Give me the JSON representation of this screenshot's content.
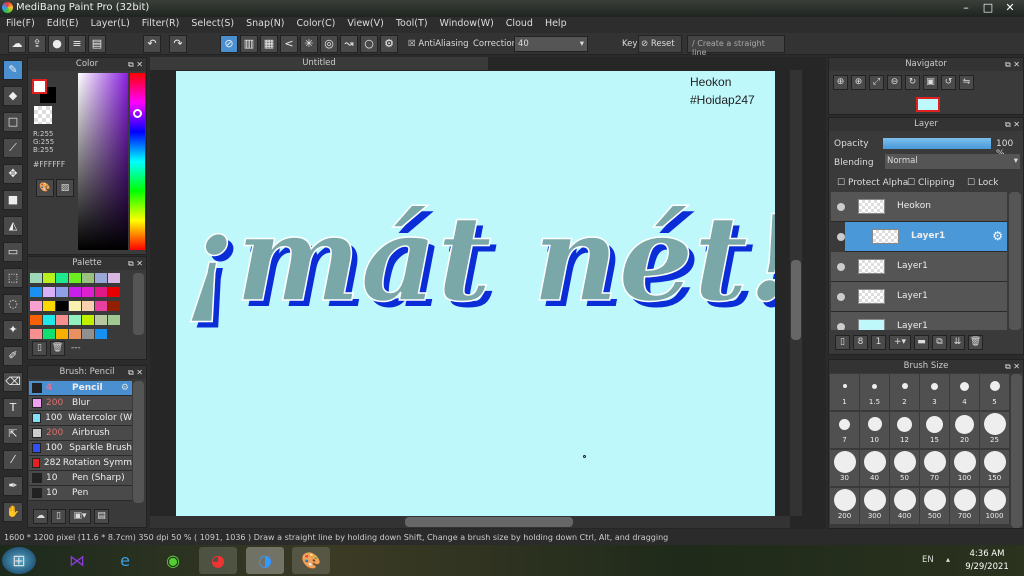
{
  "app": {
    "title": "MediBang Paint Pro (32bit)"
  },
  "menu": [
    "File(F)",
    "Edit(E)",
    "Layer(L)",
    "Filter(R)",
    "Select(S)",
    "Snap(N)",
    "Color(C)",
    "View(V)",
    "Tool(T)",
    "Window(W)",
    "Cloud",
    "Help"
  ],
  "toolbar": {
    "antialiasing": "AntiAliasing",
    "correction_label": "Correction",
    "correction_value": "40",
    "key": "Key",
    "reset": "Reset",
    "straight_line": "Create a straight line"
  },
  "color_panel": {
    "title": "Color",
    "r": "R:255",
    "g": "G:255",
    "b": "B:255",
    "hex": "#FFFFFF",
    "accent": "#4a90d0"
  },
  "palette": {
    "title": "Palette",
    "colors": [
      "#9ed9b8",
      "#b8f21a",
      "#20e88c",
      "#6cee20",
      "#9cc080",
      "#9aa8d8",
      "#d8b8e0",
      "#1a90f0",
      "#d8b0f8",
      "#90a0e8",
      "#c820e8",
      "#e020d0",
      "#e01888",
      "#e80000",
      "#f8a0d0",
      "#f8d800",
      "#000000",
      "#f8f0b0",
      "#f8d0b0",
      "#e840a0",
      "#902000",
      "#f86000",
      "#20e8e8",
      "#f89090",
      "#90f0c0",
      "#c0f000",
      "#b8c8a0",
      "#a0c890",
      "#f89090",
      "#10e070",
      "#f8b000",
      "#e89060",
      "#909090",
      "#1890f0"
    ],
    "label": "---"
  },
  "brush_panel": {
    "title": "Brush: Pencil",
    "items": [
      {
        "size": "4",
        "name": "Pencil",
        "color": "#222222",
        "size_color": "#e07090",
        "selected": true
      },
      {
        "size": "200",
        "name": "Blur",
        "color": "#f0a0f0",
        "size_color": "#e07070"
      },
      {
        "size": "100",
        "name": "Watercolor (W",
        "color": "#80e0f8",
        "size_color": "#eeeeee"
      },
      {
        "size": "200",
        "name": "Airbrush",
        "color": "#cccccc",
        "size_color": "#e07070"
      },
      {
        "size": "100",
        "name": "Sparkle Brush",
        "color": "#3050f0",
        "size_color": "#eeeeee"
      },
      {
        "size": "282",
        "name": "Rotation Symm",
        "color": "#e82020",
        "size_color": "#eeeeee"
      },
      {
        "size": "10",
        "name": "Pen (Sharp)",
        "color": "#222222",
        "size_color": "#eeeeee"
      },
      {
        "size": "10",
        "name": "Pen",
        "color": "#222222",
        "size_color": "#eeeeee"
      }
    ]
  },
  "document": {
    "tab": "Untitled",
    "signature_line1": "Heokon",
    "signature_line2": "#Hoidap247",
    "artwork_text": "¡mát nét!",
    "canvas_color": "#bff8fb"
  },
  "navigator": {
    "title": "Navigator"
  },
  "layer_panel": {
    "title": "Layer",
    "opacity_label": "Opacity",
    "opacity_value": "100 %",
    "opacity": 1.0,
    "blending_label": "Blending",
    "blending_value": "Normal",
    "protect_alpha": "Protect Alpha",
    "clipping": "Clipping",
    "lock": "Lock",
    "layers": [
      {
        "name": "Heokon",
        "selected": false
      },
      {
        "name": "Layer1",
        "selected": true
      },
      {
        "name": "Layer1",
        "selected": false
      },
      {
        "name": "Layer1",
        "selected": false
      },
      {
        "name": "Layer1",
        "selected": false
      }
    ]
  },
  "brush_size": {
    "title": "Brush Size",
    "sizes": [
      "1",
      "1.5",
      "2",
      "3",
      "4",
      "5",
      "7",
      "10",
      "12",
      "15",
      "20",
      "25",
      "30",
      "40",
      "50",
      "70",
      "100",
      "150",
      "200",
      "300",
      "400",
      "500",
      "700",
      "1000"
    ]
  },
  "status": {
    "text": "1600 * 1200 pixel  (11.6 * 8.7cm)  350 dpi  50 %  ( 1091, 1036 )  Draw a straight line by holding down Shift, Change a brush size by holding down Ctrl, Alt, and dragging"
  },
  "taskbar": {
    "lang": "EN",
    "time": "4:36 AM",
    "date": "9/29/2021"
  }
}
